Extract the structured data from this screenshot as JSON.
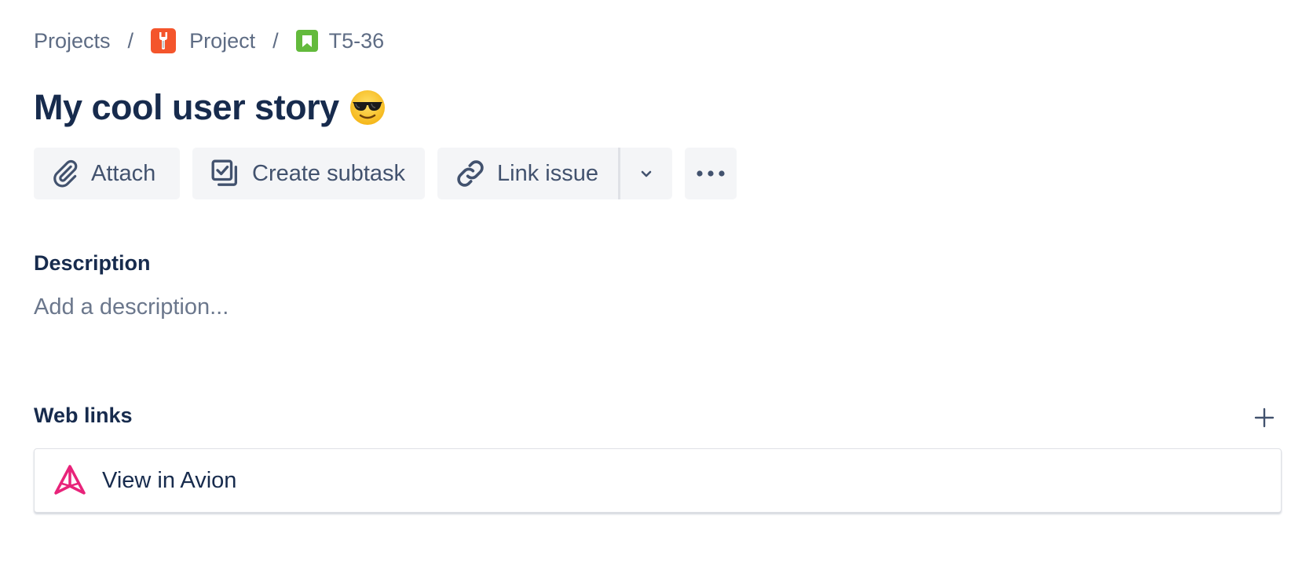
{
  "breadcrumb": {
    "projects_label": "Projects",
    "separator": "/",
    "project_label": "Project",
    "issue_key": "T5-36"
  },
  "issue": {
    "title": "My cool user story",
    "title_emoji": "sunglasses-face"
  },
  "toolbar": {
    "attach_label": "Attach",
    "create_subtask_label": "Create subtask",
    "link_issue_label": "Link issue"
  },
  "description": {
    "heading": "Description",
    "placeholder": "Add a description..."
  },
  "web_links": {
    "heading": "Web links",
    "items": [
      {
        "label": "View in Avion",
        "icon": "avion-logo-icon"
      }
    ]
  },
  "colors": {
    "text_primary": "#172b4d",
    "text_secondary": "#5e6c84",
    "button_bg": "#f4f5f7",
    "project_icon": "#f4552c",
    "story_icon": "#63ba3c",
    "avion_brand": "#e8237a"
  }
}
